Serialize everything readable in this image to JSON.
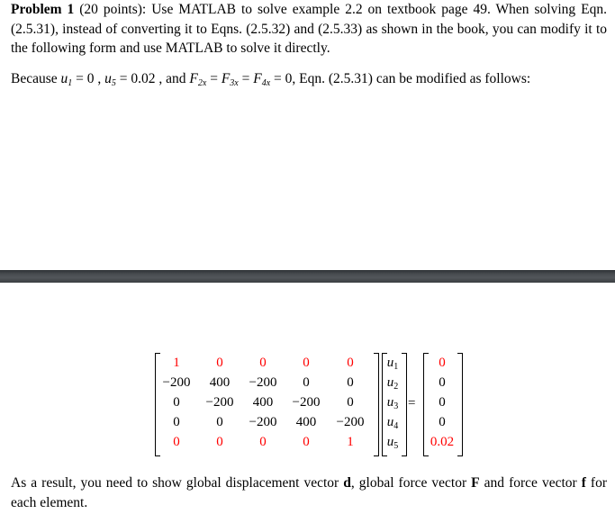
{
  "problem": {
    "title_bold": "Problem 1",
    "title_rest": " (20 points): Use MATLAB to solve example 2.2 on textbook page 49. When solving Eqn. (2.5.31), instead of converting it to Eqns. (2.5.32) and (2.5.33) as shown in the book, you can modify it to the following form and use MATLAB to solve it directly."
  },
  "because": {
    "prefix": "Because ",
    "u1": "u",
    "u1_sub": "1",
    "u1_val": " = 0 , ",
    "u5": "u",
    "u5_sub": "5",
    "u5_val": " = 0.02 ",
    "and": ", and ",
    "F2": "F",
    "F2_sub": "2x",
    "F3": "F",
    "F3_sub": "3x",
    "F4": "F",
    "F4_sub": "4x",
    "eq": " = ",
    "zero": "0",
    "suffix": ", Eqn. (2.5.31) can be modified as follows:"
  },
  "matrix": {
    "rows": [
      [
        {
          "v": "1",
          "red": true
        },
        {
          "v": "0",
          "red": true
        },
        {
          "v": "0",
          "red": true
        },
        {
          "v": "0",
          "red": true
        },
        {
          "v": "0",
          "red": true
        }
      ],
      [
        {
          "v": "−200",
          "red": false
        },
        {
          "v": "400",
          "red": false
        },
        {
          "v": "−200",
          "red": false
        },
        {
          "v": "0",
          "red": false
        },
        {
          "v": "0",
          "red": false
        }
      ],
      [
        {
          "v": "0",
          "red": false
        },
        {
          "v": "−200",
          "red": false
        },
        {
          "v": "400",
          "red": false
        },
        {
          "v": "−200",
          "red": false
        },
        {
          "v": "0",
          "red": false
        }
      ],
      [
        {
          "v": "0",
          "red": false
        },
        {
          "v": "0",
          "red": false
        },
        {
          "v": "−200",
          "red": false
        },
        {
          "v": "400",
          "red": false
        },
        {
          "v": "−200",
          "red": false
        }
      ],
      [
        {
          "v": "0",
          "red": true
        },
        {
          "v": "0",
          "red": true
        },
        {
          "v": "0",
          "red": true
        },
        {
          "v": "0",
          "red": true
        },
        {
          "v": "1",
          "red": true
        }
      ]
    ],
    "unknowns": [
      {
        "sym": "u",
        "sub": "1"
      },
      {
        "sym": "u",
        "sub": "2"
      },
      {
        "sym": "u",
        "sub": "3"
      },
      {
        "sym": "u",
        "sub": "4"
      },
      {
        "sym": "u",
        "sub": "5"
      }
    ],
    "equals": "=",
    "rhs": [
      {
        "v": "0",
        "red": true
      },
      {
        "v": "0",
        "red": false
      },
      {
        "v": "0",
        "red": false
      },
      {
        "v": "0",
        "red": false
      },
      {
        "v": "0.02",
        "red": true
      }
    ],
    "highlight_color": "#ff0000"
  },
  "result": {
    "t1": "As a result, you need to show global displacement vector ",
    "d": "d",
    "t2": ", global force vector ",
    "F": "F",
    "t3": " and force vector ",
    "f": "f",
    "t4": " for each element."
  }
}
